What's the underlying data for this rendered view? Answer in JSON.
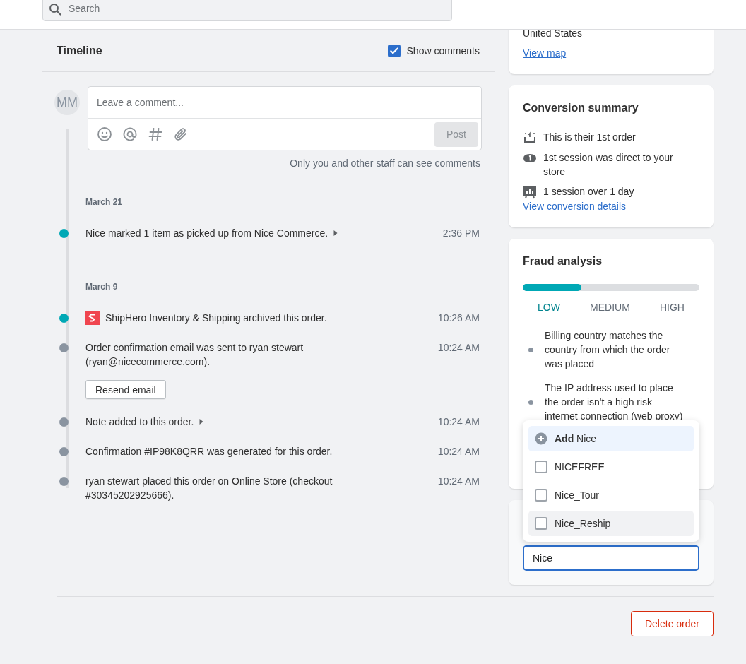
{
  "top_bar": {
    "search": {
      "placeholder": "Search"
    }
  },
  "timeline": {
    "title": "Timeline",
    "show_comments": {
      "label": "Show comments",
      "checked": true
    },
    "comment": {
      "avatar": "MM",
      "placeholder": "Leave a comment...",
      "post_button": "Post",
      "note": "Only you and other staff can see comments"
    },
    "groups": [
      {
        "date": "March 21",
        "events": [
          {
            "text": "Nice marked 1 item as picked up from Nice Commerce.",
            "time": "2:36 PM",
            "highlighted": true,
            "expandable": true,
            "logo": false
          }
        ]
      },
      {
        "date": "March 9",
        "events": [
          {
            "text": "ShipHero Inventory & Shipping archived this order.",
            "time": "10:26 AM",
            "highlighted": true,
            "expandable": false,
            "logo": true
          },
          {
            "text": "Order confirmation email was sent to ryan stewart (ryan@nicecommerce.com).",
            "time": "10:24 AM",
            "highlighted": false,
            "expandable": false,
            "logo": false,
            "button": "Resend email"
          },
          {
            "text": "Note added to this order.",
            "time": "10:24 AM",
            "highlighted": false,
            "expandable": true,
            "logo": false
          },
          {
            "text": "Confirmation #IP98K8QRR was generated for this order.",
            "time": "10:24 AM",
            "highlighted": false,
            "expandable": false,
            "logo": false
          },
          {
            "text": "ryan stewart placed this order on Online Store (checkout #30345202925666).",
            "time": "10:24 AM",
            "highlighted": false,
            "expandable": false,
            "logo": false
          }
        ]
      }
    ]
  },
  "address_card": {
    "country": "United States",
    "link": "View map"
  },
  "conversion_summary": {
    "title": "Conversion summary",
    "items": [
      {
        "kind": "order",
        "text": "This is their 1st order"
      },
      {
        "kind": "session",
        "text": "1st session was direct to your store"
      },
      {
        "kind": "chart",
        "text": "1 session over 1 day"
      }
    ],
    "link": "View conversion details"
  },
  "fraud_analysis": {
    "title": "Fraud analysis",
    "level": 0.33,
    "levels": [
      {
        "label": "LOW",
        "selected": true
      },
      {
        "label": "MEDIUM",
        "selected": false
      },
      {
        "label": "HIGH",
        "selected": false
      }
    ],
    "reasons": [
      "Billing country matches the country from which the order was placed",
      "The IP address used to place the order isn't a high risk internet connection (web proxy)"
    ]
  },
  "tags": {
    "input_value": "Nice",
    "options": [
      {
        "kind": "add",
        "label": "**Add** Nice",
        "focused": true,
        "hovered": false
      },
      {
        "kind": "checkbox",
        "label": "NICEFREE",
        "checked": false,
        "focused": false,
        "hovered": false
      },
      {
        "kind": "checkbox",
        "label": "Nice_Tour",
        "checked": false,
        "focused": false,
        "hovered": false
      },
      {
        "kind": "checkbox",
        "label": "Nice_Reship",
        "checked": false,
        "focused": false,
        "hovered": true
      }
    ]
  },
  "footer": {
    "delete_button": "Delete order"
  }
}
